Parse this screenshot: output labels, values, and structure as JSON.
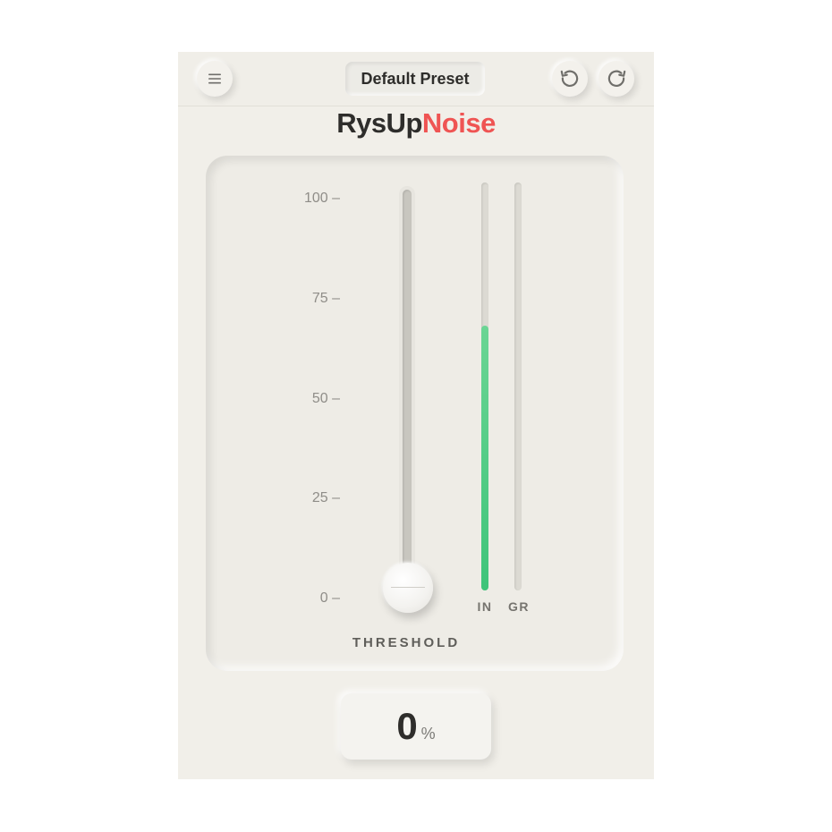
{
  "app": {
    "title_part1": "RysUp",
    "title_part2": "Noise",
    "accent_color": "#ef5453"
  },
  "toolbar": {
    "menu_icon": "hamburger-icon",
    "preset_name": "Default Preset",
    "undo_icon": "undo-icon",
    "redo_icon": "redo-icon"
  },
  "threshold": {
    "label": "THRESHOLD",
    "scale": [
      "100",
      "75",
      "50",
      "25",
      "0"
    ],
    "value": 0,
    "value_display": "0",
    "unit": "%"
  },
  "meters": {
    "in_label": "IN",
    "gr_label": "GR",
    "in_level": 0.65,
    "gr_level": 0,
    "in_color": "#4cc982"
  }
}
